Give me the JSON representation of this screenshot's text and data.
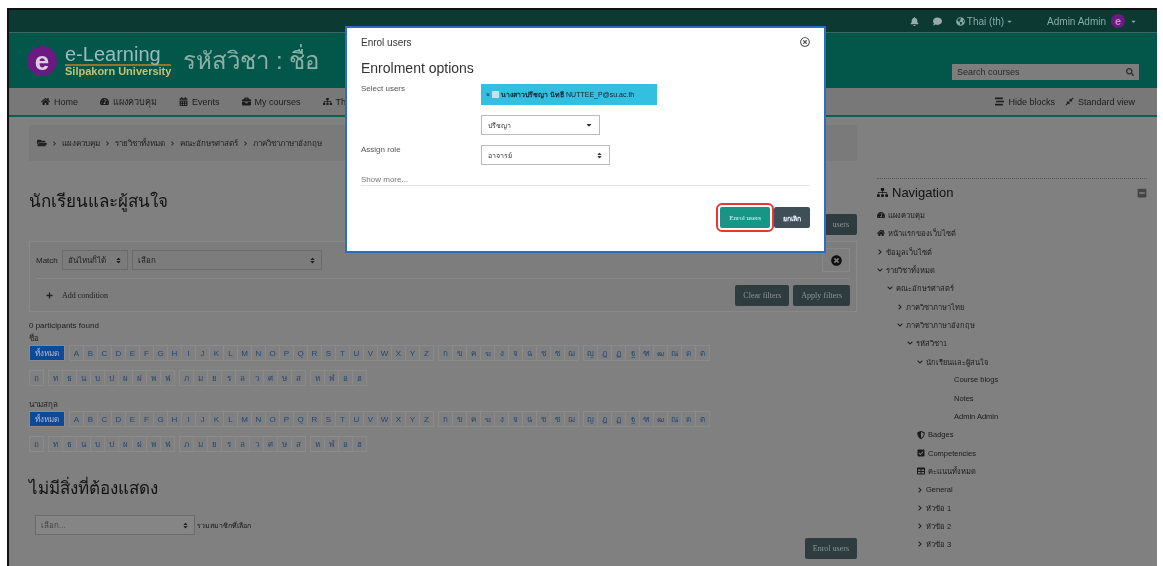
{
  "top_bar": {
    "language": "Thai (th)",
    "user": "Admin Admin",
    "avatar_letter": "e"
  },
  "header": {
    "logo_letter": "e",
    "logo_title": "e-Learning",
    "logo_subtitle": "Silpakorn University",
    "course_title": "รหัสวิชา : ชื่อ",
    "search": {
      "placeholder": "Search courses"
    }
  },
  "nav_menu": [
    {
      "label": "Home",
      "kind": "home"
    },
    {
      "label": "แผงควบคุม",
      "kind": "dashboard"
    },
    {
      "label": "Events",
      "kind": "calendar"
    },
    {
      "label": "My courses",
      "kind": "briefcase"
    },
    {
      "label": "Th",
      "kind": "sitemap"
    }
  ],
  "view_actions": [
    {
      "label": "Hide blocks",
      "kind": "hide"
    },
    {
      "label": "Standard view",
      "kind": "standard"
    }
  ],
  "breadcrumb": [
    "แผงควบคุม",
    "รายวิชาทั้งหมด",
    "คณะอักษรศาสตร์",
    "ภาควิชาภาษาอังกฤษ"
  ],
  "page_title": "นักเรียนและผู้สนใจ",
  "top_enrol_button": "users",
  "filter": {
    "match_label": "Match",
    "match_value": "อันไหนก็ได้",
    "condition_value": "เลือก",
    "add_condition": "Add condition",
    "buttons": [
      "Clear filters",
      "Apply filters"
    ]
  },
  "participants_count": "0 participants found",
  "initials_bars": [
    {
      "label": "ชื่อ",
      "letters": [
        {
          "text": "ทั้งหมด",
          "selected": true
        },
        {
          "text": "A",
          "selected": false
        },
        {
          "text": "B",
          "selected": false
        },
        {
          "text": "C",
          "selected": false
        },
        {
          "text": "D",
          "selected": false
        },
        {
          "text": "E",
          "selected": false
        },
        {
          "text": "F",
          "selected": false
        },
        {
          "text": "G",
          "selected": false
        },
        {
          "text": "H",
          "selected": false
        },
        {
          "text": "I",
          "selected": false
        },
        {
          "text": "J",
          "selected": false
        },
        {
          "text": "K",
          "selected": false
        },
        {
          "text": "L",
          "selected": false
        },
        {
          "text": "M",
          "selected": false
        },
        {
          "text": "N",
          "selected": false
        },
        {
          "text": "O",
          "selected": false
        },
        {
          "text": "P",
          "selected": false
        },
        {
          "text": "Q",
          "selected": false
        },
        {
          "text": "R",
          "selected": false
        },
        {
          "text": "S",
          "selected": false
        },
        {
          "text": "T",
          "selected": false
        },
        {
          "text": "U",
          "selected": false
        },
        {
          "text": "V",
          "selected": false
        },
        {
          "text": "W",
          "selected": false
        },
        {
          "text": "X",
          "selected": false
        },
        {
          "text": "Y",
          "selected": false
        },
        {
          "text": "Z",
          "selected": false
        },
        {
          "text": "ก",
          "selected": false
        },
        {
          "text": "ข",
          "selected": false
        },
        {
          "text": "ค",
          "selected": false
        },
        {
          "text": "ฆ",
          "selected": false
        },
        {
          "text": "ง",
          "selected": false
        },
        {
          "text": "จ",
          "selected": false
        },
        {
          "text": "ฉ",
          "selected": false
        },
        {
          "text": "ช",
          "selected": false
        },
        {
          "text": "ซ",
          "selected": false
        },
        {
          "text": "ฌ",
          "selected": false
        },
        {
          "text": "ญ",
          "selected": false
        },
        {
          "text": "ฎ",
          "selected": false
        },
        {
          "text": "ฏ",
          "selected": false
        },
        {
          "text": "ฐ",
          "selected": false
        },
        {
          "text": "ฑ",
          "selected": false
        },
        {
          "text": "ฒ",
          "selected": false
        },
        {
          "text": "ณ",
          "selected": false
        },
        {
          "text": "ด",
          "selected": false
        },
        {
          "text": "ต",
          "selected": false
        },
        {
          "text": "ถ",
          "selected": false
        },
        {
          "text": "ท",
          "selected": false
        },
        {
          "text": "ธ",
          "selected": false
        },
        {
          "text": "น",
          "selected": false
        },
        {
          "text": "บ",
          "selected": false
        },
        {
          "text": "ป",
          "selected": false
        },
        {
          "text": "ผ",
          "selected": false
        },
        {
          "text": "ฝ",
          "selected": false
        },
        {
          "text": "พ",
          "selected": false
        },
        {
          "text": "ฟ",
          "selected": false
        },
        {
          "text": "ภ",
          "selected": false
        },
        {
          "text": "ม",
          "selected": false
        },
        {
          "text": "ย",
          "selected": false
        },
        {
          "text": "ร",
          "selected": false
        },
        {
          "text": "ล",
          "selected": false
        },
        {
          "text": "ว",
          "selected": false
        },
        {
          "text": "ศ",
          "selected": false
        },
        {
          "text": "ษ",
          "selected": false
        },
        {
          "text": "ส",
          "selected": false
        },
        {
          "text": "ห",
          "selected": false
        },
        {
          "text": "ฬ",
          "selected": false
        },
        {
          "text": "อ",
          "selected": false
        },
        {
          "text": "ฮ",
          "selected": false
        }
      ]
    },
    {
      "label": "นามสกุล",
      "letters": [
        {
          "text": "ทั้งหมด",
          "selected": true
        },
        {
          "text": "A",
          "selected": false
        },
        {
          "text": "B",
          "selected": false
        },
        {
          "text": "C",
          "selected": false
        },
        {
          "text": "D",
          "selected": false
        },
        {
          "text": "E",
          "selected": false
        },
        {
          "text": "F",
          "selected": false
        },
        {
          "text": "G",
          "selected": false
        },
        {
          "text": "H",
          "selected": false
        },
        {
          "text": "I",
          "selected": false
        },
        {
          "text": "J",
          "selected": false
        },
        {
          "text": "K",
          "selected": false
        },
        {
          "text": "L",
          "selected": false
        },
        {
          "text": "M",
          "selected": false
        },
        {
          "text": "N",
          "selected": false
        },
        {
          "text": "O",
          "selected": false
        },
        {
          "text": "P",
          "selected": false
        },
        {
          "text": "Q",
          "selected": false
        },
        {
          "text": "R",
          "selected": false
        },
        {
          "text": "S",
          "selected": false
        },
        {
          "text": "T",
          "selected": false
        },
        {
          "text": "U",
          "selected": false
        },
        {
          "text": "V",
          "selected": false
        },
        {
          "text": "W",
          "selected": false
        },
        {
          "text": "X",
          "selected": false
        },
        {
          "text": "Y",
          "selected": false
        },
        {
          "text": "Z",
          "selected": false
        },
        {
          "text": "ก",
          "selected": false
        },
        {
          "text": "ข",
          "selected": false
        },
        {
          "text": "ค",
          "selected": false
        },
        {
          "text": "ฆ",
          "selected": false
        },
        {
          "text": "ง",
          "selected": false
        },
        {
          "text": "จ",
          "selected": false
        },
        {
          "text": "ฉ",
          "selected": false
        },
        {
          "text": "ช",
          "selected": false
        },
        {
          "text": "ซ",
          "selected": false
        },
        {
          "text": "ฌ",
          "selected": false
        },
        {
          "text": "ญ",
          "selected": false
        },
        {
          "text": "ฎ",
          "selected": false
        },
        {
          "text": "ฏ",
          "selected": false
        },
        {
          "text": "ฐ",
          "selected": false
        },
        {
          "text": "ฑ",
          "selected": false
        },
        {
          "text": "ฒ",
          "selected": false
        },
        {
          "text": "ณ",
          "selected": false
        },
        {
          "text": "ด",
          "selected": false
        },
        {
          "text": "ต",
          "selected": false
        },
        {
          "text": "ถ",
          "selected": false
        },
        {
          "text": "ท",
          "selected": false
        },
        {
          "text": "ธ",
          "selected": false
        },
        {
          "text": "น",
          "selected": false
        },
        {
          "text": "บ",
          "selected": false
        },
        {
          "text": "ป",
          "selected": false
        },
        {
          "text": "ผ",
          "selected": false
        },
        {
          "text": "ฝ",
          "selected": false
        },
        {
          "text": "พ",
          "selected": false
        },
        {
          "text": "ฟ",
          "selected": false
        },
        {
          "text": "ภ",
          "selected": false
        },
        {
          "text": "ม",
          "selected": false
        },
        {
          "text": "ย",
          "selected": false
        },
        {
          "text": "ร",
          "selected": false
        },
        {
          "text": "ล",
          "selected": false
        },
        {
          "text": "ว",
          "selected": false
        },
        {
          "text": "ศ",
          "selected": false
        },
        {
          "text": "ษ",
          "selected": false
        },
        {
          "text": "ส",
          "selected": false
        },
        {
          "text": "ห",
          "selected": false
        },
        {
          "text": "ฬ",
          "selected": false
        },
        {
          "text": "อ",
          "selected": false
        },
        {
          "text": "ฮ",
          "selected": false
        }
      ]
    }
  ],
  "empty_message": "ไม่มีสิ่งที่ต้องแสดง",
  "bulk_action": {
    "placeholder": "เลือก...",
    "label": "รวมสมาชิกที่เลือก"
  },
  "bottom_enrol_button": "Enrol users",
  "navigation": {
    "title": "Navigation",
    "items": [
      {
        "label": "แผงควบคุม",
        "kind": "dashboard"
      },
      {
        "label": "หน้าแรกของเว็บไซต์",
        "kind": "home"
      },
      {
        "label": "ข้อมูลเว็บไซต์",
        "kind": "branch",
        "expanded": false
      },
      {
        "label": "รายวิชาทั้งหมด",
        "kind": "branch",
        "expanded": true,
        "children": [
          {
            "label": "คณะอักษรศาสตร์",
            "kind": "branch",
            "expanded": true,
            "children": [
              {
                "label": "ภาควิชาภาษาไทย",
                "kind": "branch",
                "expanded": false
              },
              {
                "label": "ภาควิชาภาษาอังกฤษ",
                "kind": "branch",
                "expanded": true,
                "children": [
                  {
                    "label": "รหัสวิชา1",
                    "kind": "branch",
                    "expanded": true,
                    "children": [
                      {
                        "label": "นักเรียนและผู้สนใจ",
                        "kind": "branch",
                        "expanded": true,
                        "children": [
                          {
                            "label": "Course blogs",
                            "kind": "leaf"
                          },
                          {
                            "label": "Notes",
                            "kind": "leaf"
                          },
                          {
                            "label": "Admin Admin",
                            "kind": "leaf"
                          }
                        ]
                      },
                      {
                        "label": "Badges",
                        "kind": "badge"
                      },
                      {
                        "label": "Competencies",
                        "kind": "check"
                      },
                      {
                        "label": "คะแนนทั้งหมด",
                        "kind": "table"
                      },
                      {
                        "label": "General",
                        "kind": "branch",
                        "expanded": false
                      },
                      {
                        "label": "หัวข้อ 1",
                        "kind": "branch",
                        "expanded": false
                      },
                      {
                        "label": "หัวข้อ 2",
                        "kind": "branch",
                        "expanded": false
                      },
                      {
                        "label": "หัวข้อ 3",
                        "kind": "branch",
                        "expanded": false
                      }
                    ]
                  }
                ]
              }
            ]
          }
        ]
      }
    ]
  },
  "modal": {
    "title": "Enrol users",
    "heading": "Enrolment options",
    "select_users_label": "Select users",
    "selected_user": {
      "remove": "×",
      "name": "นางสาวปรีชญา นัทธี",
      "email": "NUTTEE_P@su.ac.th"
    },
    "search_value": "ปรีชญา",
    "assign_role_label": "Assign role",
    "role_value": "อาจารย์",
    "show_more": "Show more...",
    "buttons": [
      {
        "label": "Enrol users",
        "kind": "primary",
        "highlighted": true
      },
      {
        "label": "ยกเลิก",
        "kind": "secondary",
        "highlighted": false
      }
    ]
  }
}
